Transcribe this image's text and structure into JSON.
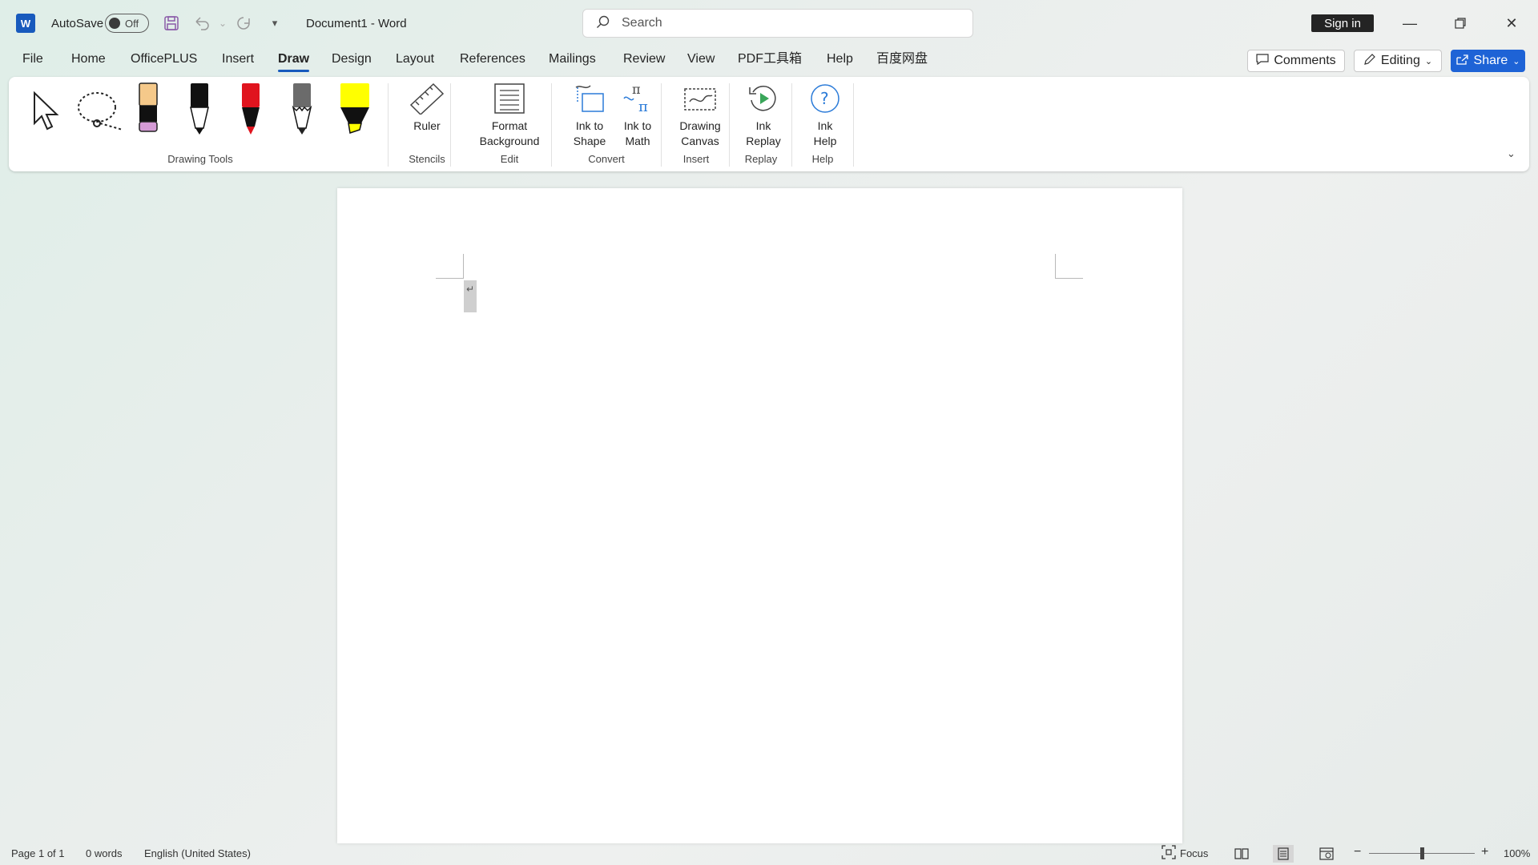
{
  "app": {
    "logo_letter": "W",
    "autosave_label": "AutoSave",
    "autosave_state": "Off",
    "doc_title": "Document1  -  Word",
    "search_placeholder": "Search",
    "sign_in": "Sign in"
  },
  "tabs": [
    "File",
    "Home",
    "OfficePLUS",
    "Insert",
    "Draw",
    "Design",
    "Layout",
    "References",
    "Mailings",
    "Review",
    "View",
    "PDF工具箱",
    "Help",
    "百度网盘"
  ],
  "active_tab": "Draw",
  "right_buttons": {
    "comments": "Comments",
    "editing": "Editing",
    "share": "Share"
  },
  "ribbon": {
    "groups": {
      "drawing_tools": "Drawing Tools",
      "stencils": "Stencils",
      "edit": "Edit",
      "convert": "Convert",
      "insert": "Insert",
      "replay": "Replay",
      "help": "Help"
    },
    "ruler": "Ruler",
    "format_background_1": "Format",
    "format_background_2": "Background",
    "ink_to_shape_1": "Ink to",
    "ink_to_shape_2": "Shape",
    "ink_to_math_1": "Ink to",
    "ink_to_math_2": "Math",
    "drawing_canvas_1": "Drawing",
    "drawing_canvas_2": "Canvas",
    "ink_replay_1": "Ink",
    "ink_replay_2": "Replay",
    "ink_help_1": "Ink",
    "ink_help_2": "Help"
  },
  "pens": [
    {
      "name": "eraser",
      "color": "#f5c98a"
    },
    {
      "name": "pen-black",
      "color": "#111111"
    },
    {
      "name": "pen-red",
      "color": "#e0141e"
    },
    {
      "name": "pencil-gray",
      "color": "#6b6b6b"
    },
    {
      "name": "highlighter-yellow",
      "color": "#ffff00"
    }
  ],
  "status": {
    "page": "Page 1 of 1",
    "words": "0 words",
    "language": "English (United States)",
    "focus": "Focus",
    "zoom": "100%"
  },
  "colors": {
    "accent": "#185abd",
    "share": "#1e63d6"
  }
}
